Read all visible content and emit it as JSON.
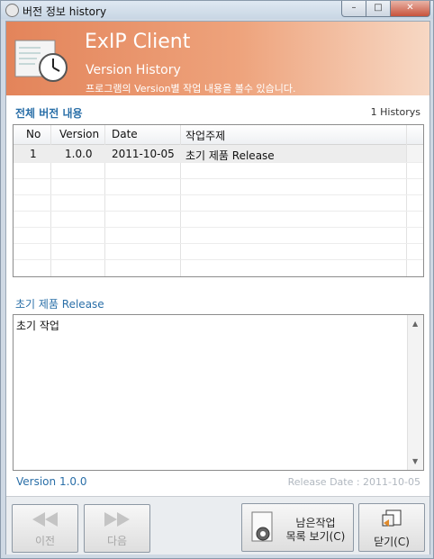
{
  "window": {
    "title": "버전 정보 history"
  },
  "header": {
    "app_name": "ExIP Client",
    "subtitle": "Version History",
    "description": "프로그램의 Version별 작업 내용을 볼수 있습니다."
  },
  "history": {
    "section_title": "전체 버전 내용",
    "count_text": "1 Historys",
    "columns": [
      "No",
      "Version",
      "Date",
      "작업주제"
    ],
    "rows": [
      {
        "no": "1",
        "version": "1.0.0",
        "date": "2011-10-05",
        "subject": "초기 제품 Release"
      }
    ]
  },
  "detail": {
    "title": "초기 제품 Release",
    "body": "초기 작업"
  },
  "footer": {
    "version": "Version 1.0.0",
    "release_date": "Release Date : 2011-10-05"
  },
  "buttons": {
    "prev": "이전",
    "next": "다음",
    "remaining_line1": "남은작업",
    "remaining_line2": "목록 보기(C)",
    "close": "닫기(C)"
  },
  "colors": {
    "banner": "#e3845a",
    "accent": "#2a6fa8"
  }
}
